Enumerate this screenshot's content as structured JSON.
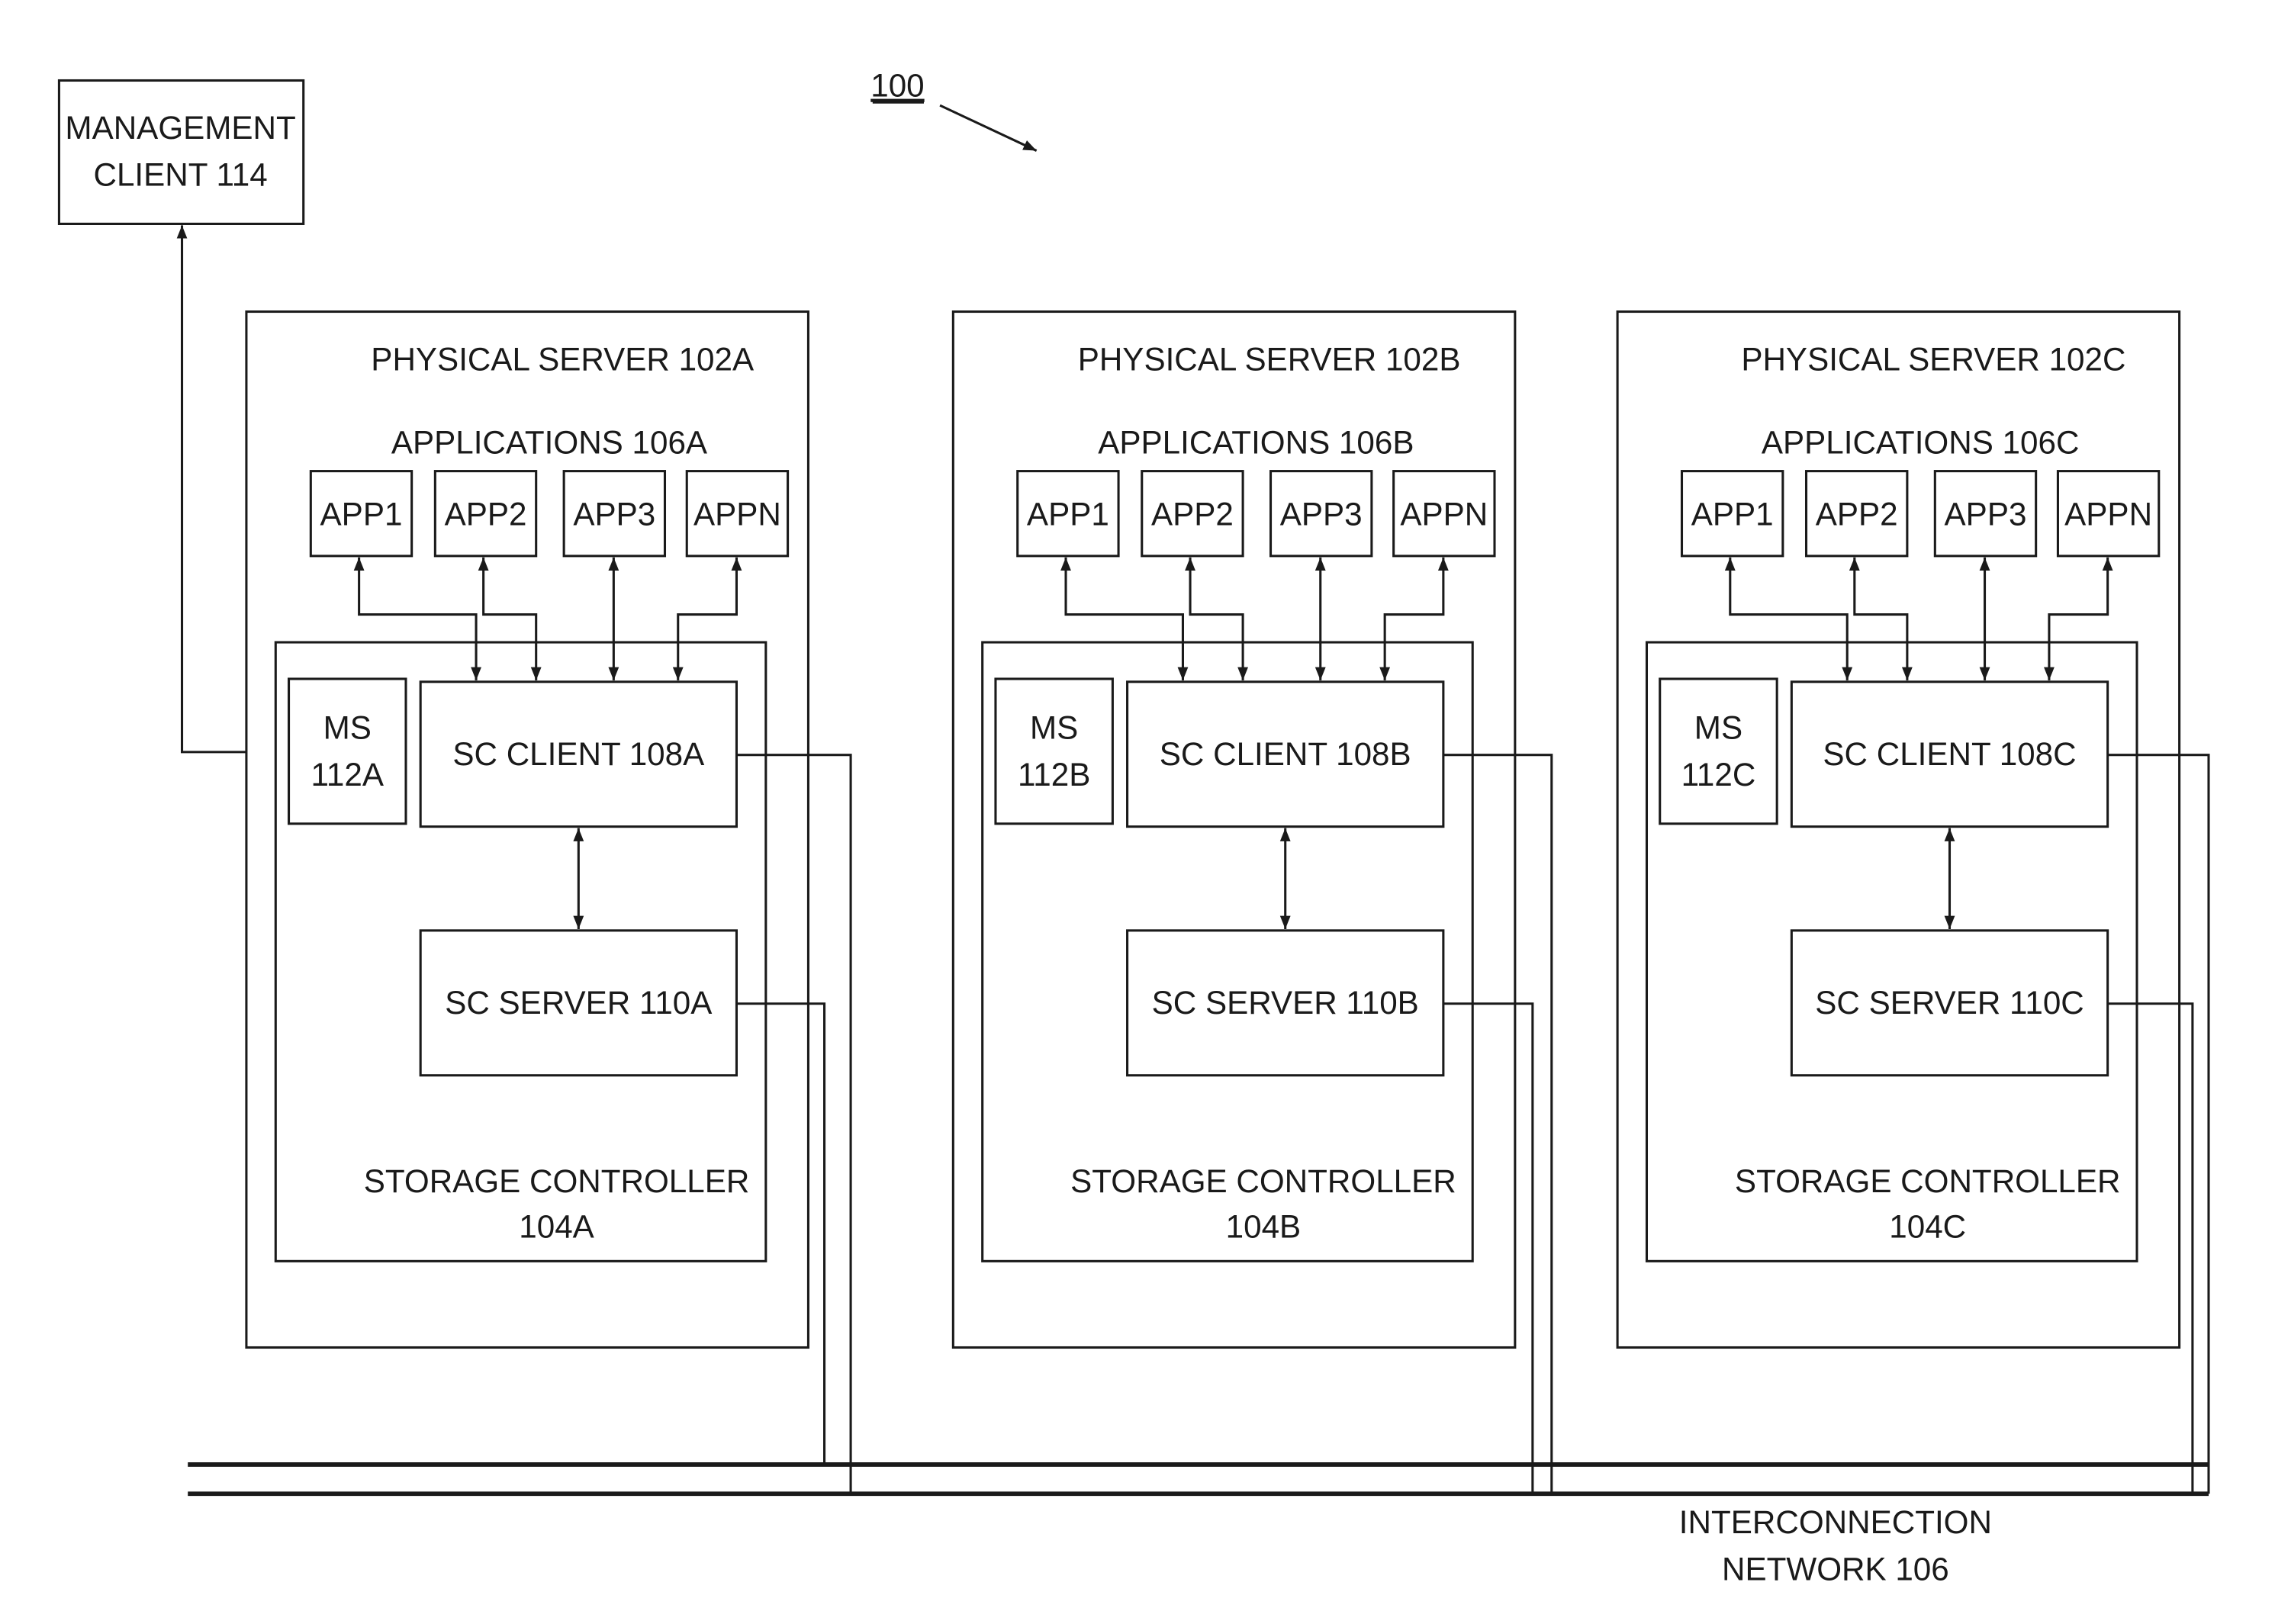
{
  "figure": {
    "reference": "100",
    "management_client": {
      "line1": "MANAGEMENT",
      "line2": "CLIENT 114"
    },
    "network": {
      "line1": "INTERCONNECTION",
      "line2": "NETWORK 106"
    },
    "servers": [
      {
        "title": "PHYSICAL SERVER 102A",
        "applications_label": "APPLICATIONS 106A",
        "apps": [
          "APP1",
          "APP2",
          "APP3",
          "APPN"
        ],
        "ms": {
          "line1": "MS",
          "line2": "112A"
        },
        "sc_client": "SC CLIENT 108A",
        "sc_server": "SC SERVER 110A",
        "storage_controller": {
          "line1": "STORAGE CONTROLLER",
          "line2": "104A"
        }
      },
      {
        "title": "PHYSICAL SERVER 102B",
        "applications_label": "APPLICATIONS 106B",
        "apps": [
          "APP1",
          "APP2",
          "APP3",
          "APPN"
        ],
        "ms": {
          "line1": "MS",
          "line2": "112B"
        },
        "sc_client": "SC CLIENT 108B",
        "sc_server": "SC SERVER 110B",
        "storage_controller": {
          "line1": "STORAGE CONTROLLER",
          "line2": "104B"
        }
      },
      {
        "title": "PHYSICAL SERVER 102C",
        "applications_label": "APPLICATIONS 106C",
        "apps": [
          "APP1",
          "APP2",
          "APP3",
          "APPN"
        ],
        "ms": {
          "line1": "MS",
          "line2": "112C"
        },
        "sc_client": "SC CLIENT 108C",
        "sc_server": "SC SERVER 110C",
        "storage_controller": {
          "line1": "STORAGE CONTROLLER",
          "line2": "104C"
        }
      }
    ]
  }
}
